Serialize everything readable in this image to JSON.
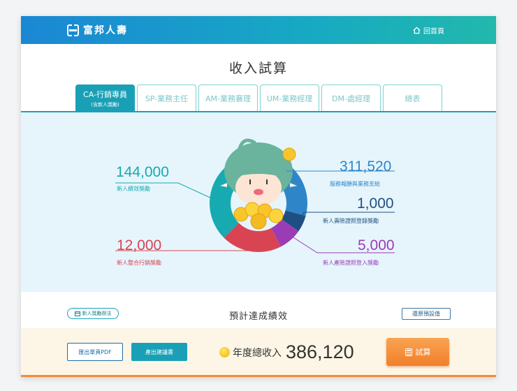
{
  "header": {
    "brand": "富邦人壽",
    "home_label": "回首頁"
  },
  "page_title": "收入試算",
  "tabs": [
    {
      "label": "CA-行銷專員",
      "sub": "(含新人獎勵)",
      "active": true
    },
    {
      "label": "SP-業務主任",
      "active": false
    },
    {
      "label": "AM-業務襄理",
      "active": false
    },
    {
      "label": "UM-業務經理",
      "active": false
    },
    {
      "label": "DM-處經理",
      "active": false
    },
    {
      "label": "總表",
      "active": false
    }
  ],
  "chart_data": {
    "type": "pie",
    "segments": [
      {
        "label": "服務報酬與業務支給",
        "value": 311520,
        "display": "311,520",
        "color": "#2e86c8"
      },
      {
        "label": "新人壽險證照登錄獎勵",
        "value": 1000,
        "display": "1,000",
        "color": "#1f4f82"
      },
      {
        "label": "新人產險證照登入獎勵",
        "value": 5000,
        "display": "5,000",
        "color": "#9c3cb5"
      },
      {
        "label": "新人整合行銷獎勵",
        "value": 12000,
        "display": "12,000",
        "color": "#d94452"
      },
      {
        "label": "新人績效獎勵",
        "value": 144000,
        "display": "144,000",
        "color": "#17aab0"
      }
    ]
  },
  "labels": {
    "service": {
      "value": "311,520",
      "text": "服務報酬與業務支給"
    },
    "life": {
      "value": "1,000",
      "text": "新人壽險證照登錄獎勵"
    },
    "property": {
      "value": "5,000",
      "text": "新人產險證照登入獎勵"
    },
    "integrated": {
      "value": "12,000",
      "text": "新人整合行銷獎勵"
    },
    "performance": {
      "value": "144,000",
      "text": "新人績效獎勵"
    }
  },
  "bottom": {
    "rules_label": "新人獎勵辦法",
    "performance_title": "預計達成績效",
    "reset_label": "還原預設值"
  },
  "footer": {
    "pdf_label": "匯出單頁PDF",
    "proposal_label": "產出建議書",
    "total_label": "年度總收入",
    "total_value": "386,120",
    "calc_label": "試算"
  },
  "colors": {
    "accent": "#1aa0b6",
    "orange": "#f18a3d"
  }
}
